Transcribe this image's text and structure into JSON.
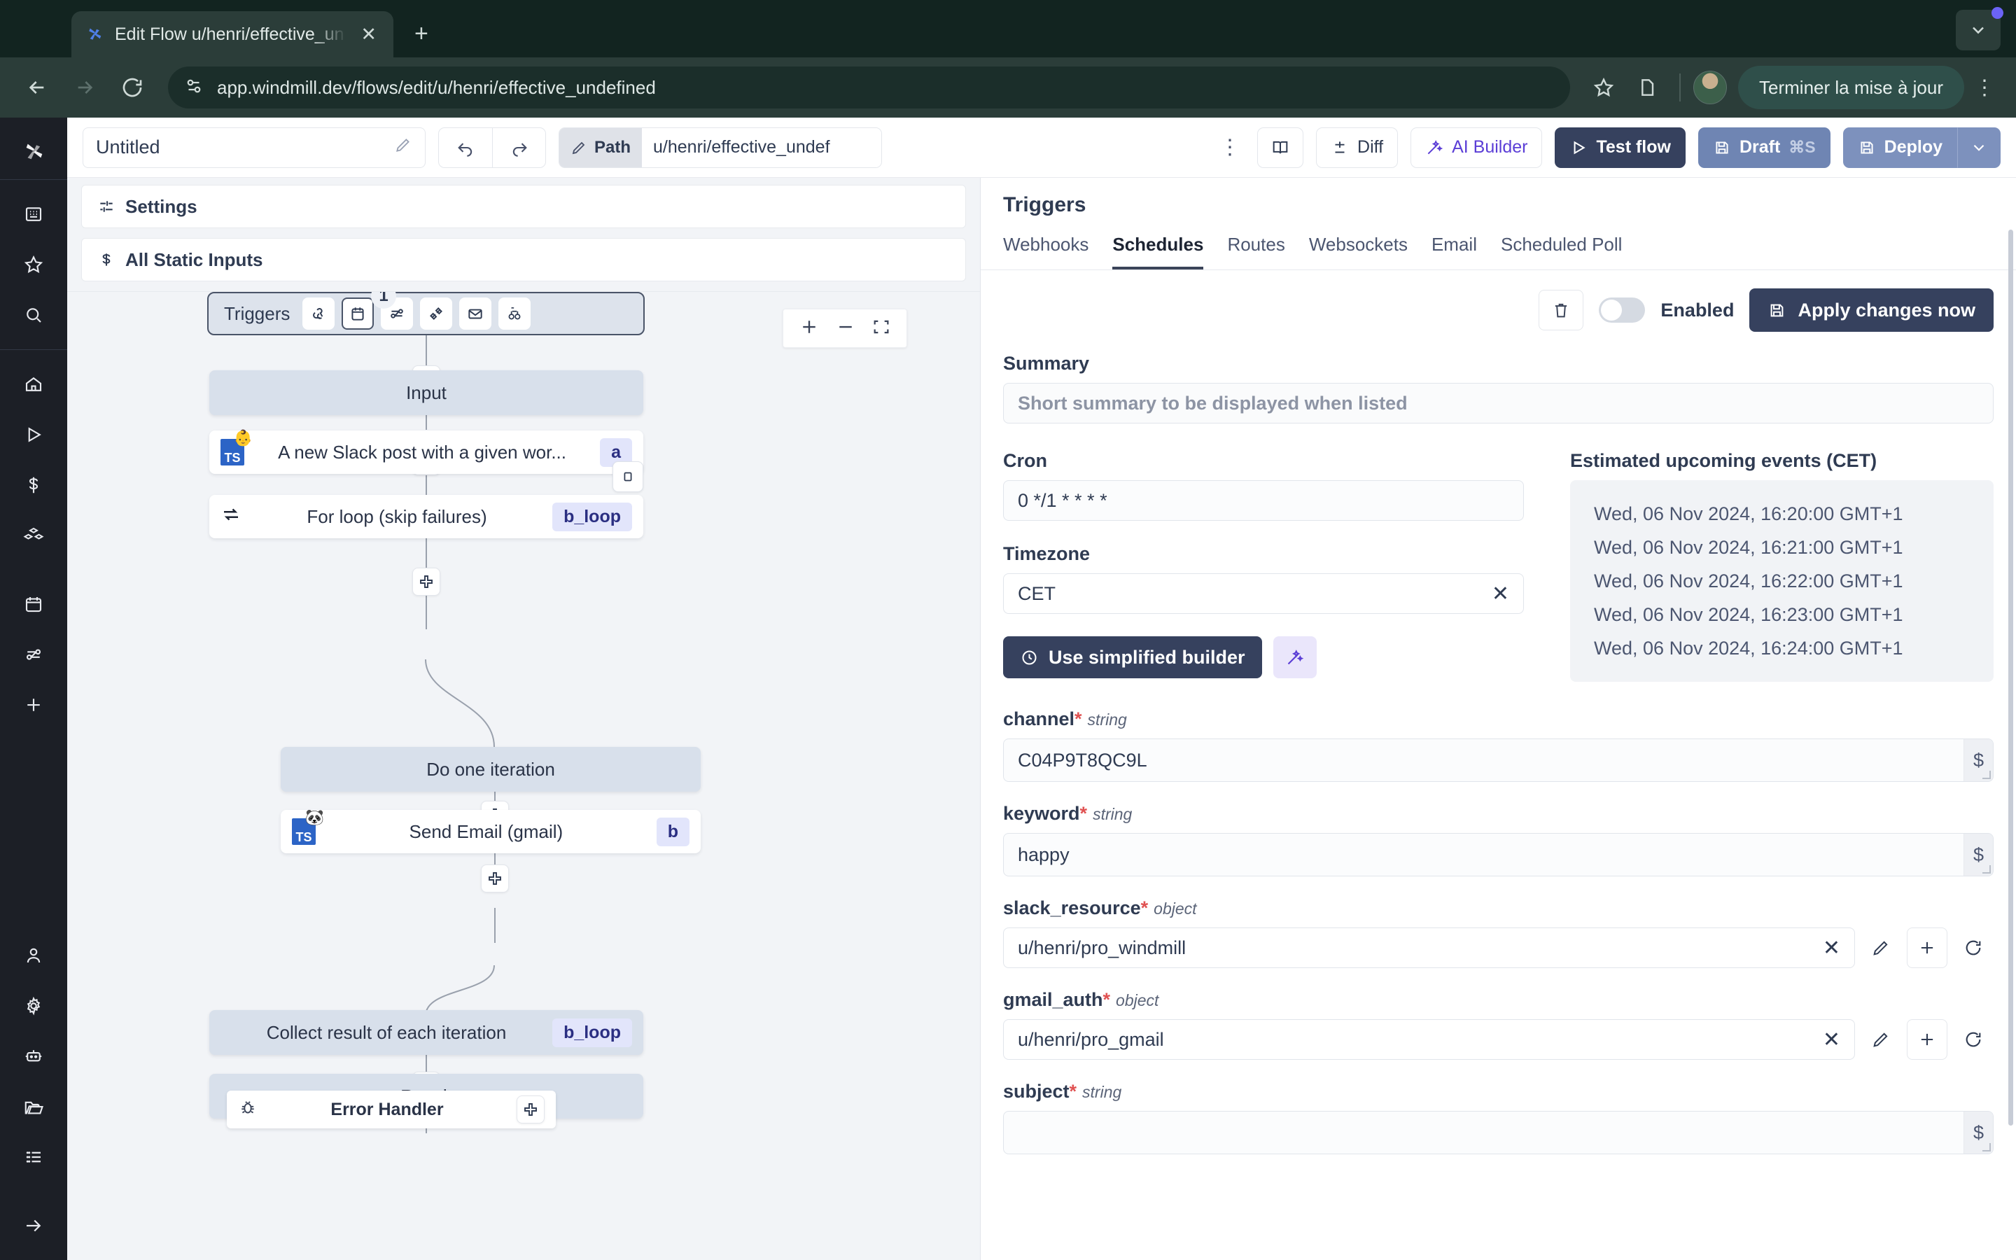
{
  "browser": {
    "tab_title": "Edit Flow u/henri/effective_un",
    "url": "app.windmill.dev/flows/edit/u/henri/effective_undefined",
    "update_button": "Terminer la mise à jour",
    "icons": {
      "back": "back-arrow-icon",
      "forward": "forward-arrow-icon",
      "reload": "reload-icon",
      "site_info": "site-settings-icon",
      "bookmark": "star-icon",
      "extensions": "extensions-icon",
      "profile": "avatar",
      "menu": "kebab-menu-icon",
      "new_tab": "+",
      "close_tab": "✕",
      "collapse": "chevron-down-icon"
    }
  },
  "rail": {
    "logo": "windmill-logo",
    "groups": [
      {
        "items": [
          {
            "name": "workspace-icon",
            "glyph": "building"
          },
          {
            "name": "favorites-icon",
            "glyph": "star"
          },
          {
            "name": "search-icon",
            "glyph": "search"
          }
        ]
      },
      {
        "items": [
          {
            "name": "home-icon",
            "glyph": "home"
          },
          {
            "name": "runs-icon",
            "glyph": "play"
          },
          {
            "name": "pricing-icon",
            "glyph": "dollar"
          },
          {
            "name": "resources-icon",
            "glyph": "boxes"
          }
        ]
      },
      {
        "items": [
          {
            "name": "schedules-icon",
            "glyph": "calendar"
          },
          {
            "name": "triggers-icon",
            "glyph": "route"
          },
          {
            "name": "add-icon",
            "glyph": "plus"
          }
        ]
      },
      {
        "items": [
          {
            "name": "account-icon",
            "glyph": "user"
          },
          {
            "name": "settings-icon",
            "glyph": "gear"
          },
          {
            "name": "ai-agent-icon",
            "glyph": "robot"
          },
          {
            "name": "folders-icon",
            "glyph": "folder"
          },
          {
            "name": "variables-icon",
            "glyph": "list"
          }
        ]
      },
      {
        "items": [
          {
            "name": "expand-sidebar-icon",
            "glyph": "arrow-right"
          }
        ]
      }
    ]
  },
  "toolbar": {
    "flow_name": "Untitled",
    "edit_name_icon": "pencil-icon",
    "undo_icon": "undo-icon",
    "redo_icon": "redo-icon",
    "path_label": "Path",
    "path_value": "u/henri/effective_undef",
    "more_icon": "kebab-menu-icon",
    "docs_icon": "book-icon",
    "diff_label": "Diff",
    "ai_builder_label": "AI Builder",
    "test_flow_label": "Test flow",
    "draft_label": "Draft",
    "draft_shortcut": "⌘S",
    "deploy_label": "Deploy"
  },
  "canvas": {
    "settings_label": "Settings",
    "static_inputs_label": "All Static Inputs",
    "zoom": {
      "in": "+",
      "out": "−",
      "fit": "fit-view-icon"
    },
    "triggers_label": "Triggers",
    "triggers_badge": "1",
    "trigger_icons": [
      "webhook-icon",
      "schedule-calendar-icon",
      "routes-icon",
      "websocket-icon",
      "email-icon",
      "scheduled-poll-icon"
    ],
    "nodes": [
      {
        "label": "Input",
        "kind": "gray"
      },
      {
        "label": "A new Slack post with a given wor...",
        "kind": "script",
        "pill": "a",
        "lang": "TS",
        "emoji": "👶"
      },
      {
        "label": "For loop (skip failures)",
        "kind": "white",
        "pill": "b_loop",
        "icon": "loop-icon"
      },
      {
        "label": "Do one iteration",
        "kind": "gray"
      },
      {
        "label": "Send Email (gmail)",
        "kind": "script",
        "pill": "b",
        "lang": "TS",
        "emoji": "🐼"
      },
      {
        "label": "Collect result of each iteration",
        "kind": "gray",
        "pill": "b_loop"
      },
      {
        "label": "Result",
        "kind": "gray"
      }
    ],
    "error_handler_label": "Error Handler",
    "error_handler_icon": "bug-icon"
  },
  "panel": {
    "title": "Triggers",
    "tabs": [
      {
        "label": "Webhooks",
        "active": false
      },
      {
        "label": "Schedules",
        "active": true
      },
      {
        "label": "Routes",
        "active": false
      },
      {
        "label": "Websockets",
        "active": false
      },
      {
        "label": "Email",
        "active": false
      },
      {
        "label": "Scheduled Poll",
        "active": false
      }
    ],
    "delete_icon": "trash-icon",
    "enabled_label": "Enabled",
    "enabled_state": "off",
    "apply_label": "Apply changes now",
    "apply_icon": "save-icon",
    "summary_label": "Summary",
    "summary_placeholder": "Short summary to be displayed when listed",
    "summary_value": "",
    "cron_label": "Cron",
    "cron_value": "0 */1 * * * *",
    "timezone_label": "Timezone",
    "timezone_value": "CET",
    "timezone_clear_icon": "close-icon",
    "simplified_builder_label": "Use simplified builder",
    "simplified_builder_icon": "clock-icon",
    "wand_icon": "magic-wand-icon",
    "events_title": "Estimated upcoming events (CET)",
    "events": [
      "Wed, 06 Nov 2024, 16:20:00 GMT+1",
      "Wed, 06 Nov 2024, 16:21:00 GMT+1",
      "Wed, 06 Nov 2024, 16:22:00 GMT+1",
      "Wed, 06 Nov 2024, 16:23:00 GMT+1",
      "Wed, 06 Nov 2024, 16:24:00 GMT+1"
    ],
    "fields": [
      {
        "name": "channel",
        "required": "*",
        "type": "string",
        "value": "C04P9T8QC9L",
        "widget": "textarea-dollar"
      },
      {
        "name": "keyword",
        "required": "*",
        "type": "string",
        "value": "happy",
        "widget": "textarea-dollar"
      },
      {
        "name": "slack_resource",
        "required": "*",
        "type": "object",
        "value": "u/henri/pro_windmill",
        "widget": "resource"
      },
      {
        "name": "gmail_auth",
        "required": "*",
        "type": "object",
        "value": "u/henri/pro_gmail",
        "widget": "resource"
      },
      {
        "name": "subject",
        "required": "*",
        "type": "string",
        "value": "",
        "widget": "textarea-dollar"
      }
    ],
    "resource_icons": {
      "clear": "close-icon",
      "edit": "pencil-icon",
      "add": "plus-icon",
      "refresh": "refresh-icon"
    }
  },
  "colors": {
    "accent_dark": "#36415e",
    "accent_blue": "#7d91bd",
    "ai_purple": "#5b3ed6",
    "required_red": "#e05252",
    "chrome_bg": "#122420"
  }
}
